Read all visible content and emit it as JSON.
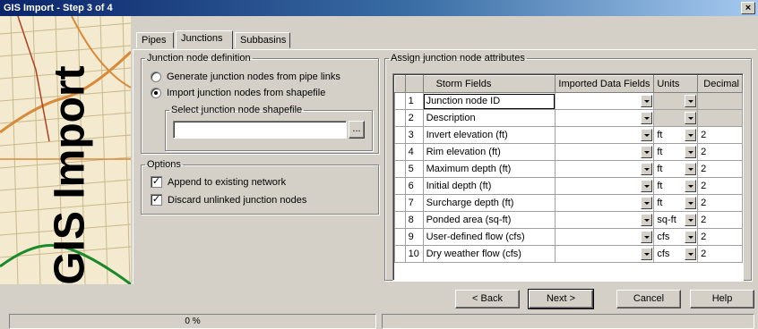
{
  "window": {
    "title": "GIS Import - Step 3 of 4",
    "close_label": "×"
  },
  "side_banner": {
    "text": "GIS Import"
  },
  "tabs": [
    {
      "label": "Pipes",
      "active": false
    },
    {
      "label": "Junctions",
      "active": true
    },
    {
      "label": "Subbasins",
      "active": false
    }
  ],
  "definition": {
    "legend": "Junction node definition",
    "option_generate": "Generate junction nodes from pipe links",
    "option_import": "Import junction nodes from shapefile",
    "selected": "import",
    "shapefile_legend": "Select junction node shapefile",
    "shapefile_value": "",
    "browse_label": "..."
  },
  "options": {
    "legend": "Options",
    "append_label": "Append to existing network",
    "append_checked": true,
    "discard_label": "Discard unlinked junction nodes",
    "discard_checked": true
  },
  "attributes": {
    "legend": "Assign junction node attributes",
    "columns": [
      "",
      "Storm Fields",
      "Imported Data Fields",
      "Units",
      "Decimal"
    ],
    "rows": [
      {
        "n": "1",
        "field": "Junction node ID",
        "imported": "",
        "units": "",
        "decimal": ""
      },
      {
        "n": "2",
        "field": "Description",
        "imported": "",
        "units": "",
        "decimal": ""
      },
      {
        "n": "3",
        "field": "Invert elevation (ft)",
        "imported": "",
        "units": "ft",
        "decimal": "2"
      },
      {
        "n": "4",
        "field": "Rim elevation (ft)",
        "imported": "",
        "units": "ft",
        "decimal": "2"
      },
      {
        "n": "5",
        "field": "Maximum depth (ft)",
        "imported": "",
        "units": "ft",
        "decimal": "2"
      },
      {
        "n": "6",
        "field": "Initial depth (ft)",
        "imported": "",
        "units": "ft",
        "decimal": "2"
      },
      {
        "n": "7",
        "field": "Surcharge depth (ft)",
        "imported": "",
        "units": "ft",
        "decimal": "2"
      },
      {
        "n": "8",
        "field": "Ponded area (sq-ft)",
        "imported": "",
        "units": "sq-ft",
        "decimal": "2"
      },
      {
        "n": "9",
        "field": "User-defined flow (cfs)",
        "imported": "",
        "units": "cfs",
        "decimal": "2"
      },
      {
        "n": "10",
        "field": "Dry weather flow (cfs)",
        "imported": "",
        "units": "cfs",
        "decimal": "2"
      }
    ]
  },
  "buttons": {
    "back": "< Back",
    "next": "Next >",
    "cancel": "Cancel",
    "help": "Help"
  },
  "status": {
    "progress_text": "0 %",
    "progress_percent": 0
  },
  "colors": {
    "title_start": "#0a246a",
    "title_end": "#a6caf0",
    "face": "#d4d0c8",
    "map_bg": "#f3ead0"
  }
}
